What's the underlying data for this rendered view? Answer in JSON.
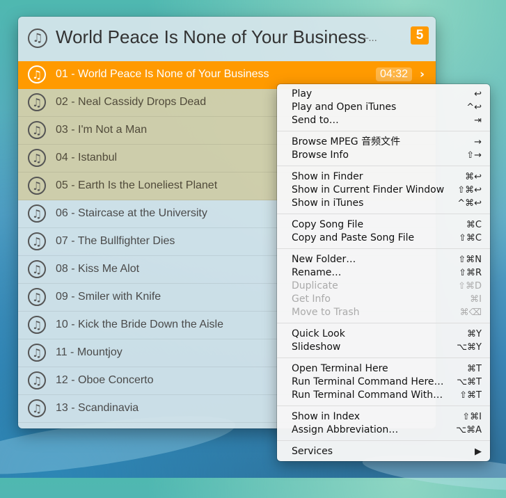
{
  "header": {
    "title": "World Peace Is None of Your Business",
    "dash": "–...",
    "count": "5"
  },
  "rows": [
    {
      "label": "01 - World Peace Is None of Your Business",
      "time": "04:32",
      "state": "selected"
    },
    {
      "label": "02 - Neal Cassidy Drops Dead",
      "state": "tinted"
    },
    {
      "label": "03 - I'm Not a Man",
      "state": "tinted"
    },
    {
      "label": "04 - Istanbul",
      "state": "tinted"
    },
    {
      "label": "05 - Earth Is the Loneliest Planet",
      "state": "tinted"
    },
    {
      "label": "06 - Staircase at the University",
      "state": "normal"
    },
    {
      "label": "07 - The Bullfighter Dies",
      "state": "normal"
    },
    {
      "label": "08 - Kiss Me Alot",
      "state": "normal"
    },
    {
      "label": "09 - Smiler with Knife",
      "state": "normal"
    },
    {
      "label": "10 - Kick the Bride Down the Aisle",
      "state": "normal"
    },
    {
      "label": "11 - Mountjoy",
      "state": "normal"
    },
    {
      "label": "12 - Oboe Concerto",
      "state": "normal"
    },
    {
      "label": "13 - Scandinavia",
      "state": "normal"
    }
  ],
  "menu": {
    "groups": [
      [
        {
          "label": "Play",
          "shortcut": "↩"
        },
        {
          "label": "Play and Open iTunes",
          "shortcut": "^↩"
        },
        {
          "label": "Send to…",
          "shortcut": "⇥"
        }
      ],
      [
        {
          "label": "Browse MPEG 音频文件",
          "shortcut": "→"
        },
        {
          "label": "Browse Info",
          "shortcut": "⇧→"
        }
      ],
      [
        {
          "label": "Show in Finder",
          "shortcut": "⌘↩"
        },
        {
          "label": "Show in Current Finder Window",
          "shortcut": "⇧⌘↩"
        },
        {
          "label": "Show in iTunes",
          "shortcut": "^⌘↩"
        }
      ],
      [
        {
          "label": "Copy Song File",
          "shortcut": "⌘C"
        },
        {
          "label": "Copy and Paste Song File",
          "shortcut": "⇧⌘C"
        }
      ],
      [
        {
          "label": "New Folder…",
          "shortcut": "⇧⌘N"
        },
        {
          "label": "Rename…",
          "shortcut": "⇧⌘R"
        },
        {
          "label": "Duplicate",
          "shortcut": "⇧⌘D",
          "disabled": true
        },
        {
          "label": "Get Info",
          "shortcut": "⌘I",
          "disabled": true
        },
        {
          "label": "Move to Trash",
          "shortcut": "⌘⌫",
          "disabled": true
        }
      ],
      [
        {
          "label": "Quick Look",
          "shortcut": "⌘Y"
        },
        {
          "label": "Slideshow",
          "shortcut": "⌥⌘Y"
        }
      ],
      [
        {
          "label": "Open Terminal Here",
          "shortcut": "⌘T"
        },
        {
          "label": "Run Terminal Command Here…",
          "shortcut": "⌥⌘T"
        },
        {
          "label": "Run Terminal Command With…",
          "shortcut": "⇧⌘T"
        }
      ],
      [
        {
          "label": "Show in Index",
          "shortcut": "⇧⌘I"
        },
        {
          "label": "Assign Abbreviation…",
          "shortcut": "⌥⌘A"
        }
      ],
      [
        {
          "label": "Services",
          "shortcut": "▶"
        }
      ]
    ]
  },
  "icons": {
    "note": "♫",
    "chevron": "›"
  },
  "colors": {
    "accent": "#ff9a00"
  }
}
